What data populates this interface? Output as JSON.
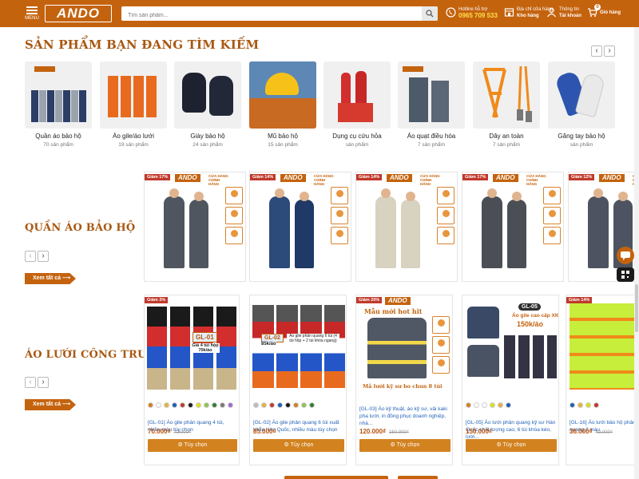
{
  "header": {
    "menu_label": "MENU",
    "logo_text": "ANDO",
    "search_placeholder": "Tìm sản phẩm...",
    "hotline_label": "Hotline hỗ trợ",
    "hotline_number": "0965 709 533",
    "stores_label": "Địa chỉ cửa hàng",
    "stores_value": "Kho hàng",
    "account_label": "Thông tin",
    "account_value": "Tài khoản",
    "cart_label": "Giỏ hàng",
    "cart_count": "0"
  },
  "searching_section": {
    "title": "SẢN PHẨM BẠN ĐANG TÌM KIẾM",
    "categories": [
      {
        "name": "Quần áo bảo hộ",
        "count": "70 sản phẩm"
      },
      {
        "name": "Áo gile/áo lưới",
        "count": "19 sản phẩm"
      },
      {
        "name": "Giày bảo hộ",
        "count": "24 sản phẩm"
      },
      {
        "name": "Mũ bảo hộ",
        "count": "15 sản phẩm"
      },
      {
        "name": "Dụng cụ cứu hỏa",
        "count": "sản phẩm"
      },
      {
        "name": "Áo quạt điều hòa",
        "count": "7 sản phẩm"
      },
      {
        "name": "Dây an toàn",
        "count": "7 sản phẩm"
      },
      {
        "name": "Găng tay bảo hộ",
        "count": "sản phẩm"
      }
    ]
  },
  "workwear_section": {
    "title": "QUẦN ÁO BẢO HỘ",
    "see_all": "Xem tất cả",
    "cards": [
      {
        "discount": "Giảm 17%"
      },
      {
        "discount": "Giảm 14%"
      },
      {
        "discount": "Giảm 14%"
      },
      {
        "discount": "Giảm 17%"
      },
      {
        "discount": "Giảm 12%"
      }
    ],
    "brand": "ANDO",
    "store_text": "CỬA HÀNG CHÍNH HÃNG"
  },
  "vest_section": {
    "title": "ÁO LƯỚI CÔNG TRƯỜNG",
    "see_all": "Xem tất cả",
    "choose_label": "Tùy chọn",
    "cards": [
      {
        "discount": "Giảm 3%",
        "img_code": "GL-01",
        "img_caption": "Giá 4 túi hộp 70k/áo",
        "desc": "[GL-01] Áo gile phản quang 4 túi, nhiều màu tùy chọn",
        "price": "70.000₫",
        "old_price": "72.000₫",
        "colors": [
          "#d2821f",
          "#ffffff",
          "#e3b23c",
          "#1f5fb5",
          "#c0392b",
          "#1a1a1a",
          "#d9e021",
          "#8bc34a",
          "#2e7d32",
          "#777777",
          "#9c6ad6"
        ]
      },
      {
        "discount": "",
        "img_code": "GL-02",
        "img_caption": "Áo gile phản quang 6 túi (4 túi hộp + 2 túi khóa ngang)",
        "img_price": "85k/áo",
        "desc": "[GL-02] Áo gile phản quang 6 túi xuất khẩu Hàn Quốc, nhiều màu tùy chọn",
        "price": "85.000₫",
        "old_price": "",
        "colors": [
          "#bbbbbb",
          "#e3b23c",
          "#c0392b",
          "#1f5fb5",
          "#1a1a1a",
          "#d2821f",
          "#8bc34a",
          "#2e7d32"
        ]
      },
      {
        "discount": "Giảm 20%",
        "img_code": "",
        "img_caption": "Mẫu mới hot hit",
        "img_caption2": "Mã lưới kỹ sư bo chun 8 túi",
        "desc": "[GL-03] Áo kỹ thuật, áo kỹ sư, vải kaki pha lưới, in đồng phục doanh nghiệp, nhà...",
        "price": "120.000₫",
        "old_price": "150.000₫",
        "colors": []
      },
      {
        "discount": "",
        "img_code": "GL-05",
        "img_caption": "Áo gile cao cấp XK",
        "img_price": "150k/áo",
        "desc": "[GL-05] Áo lưới phản quang kỹ sư Hàn Quốc chất lượng cao, 6 túi khóa kéo, lưới...",
        "price": "150.000₫",
        "old_price": "",
        "colors": [
          "#d2821f",
          "#ffffff",
          "#ffffff",
          "#d9e021",
          "#e3b23c",
          "#1f5fb5"
        ]
      },
      {
        "discount": "Giảm 14%",
        "img_code": "",
        "img_caption": "",
        "desc": "[GL-16] Áo lưới bảo hộ phản quang 2 màu",
        "price": "36.000₫",
        "old_price": "42.000₫",
        "colors": [
          "#1f5fb5",
          "#e3b23c",
          "#d9e021",
          "#c0392b"
        ]
      }
    ]
  }
}
